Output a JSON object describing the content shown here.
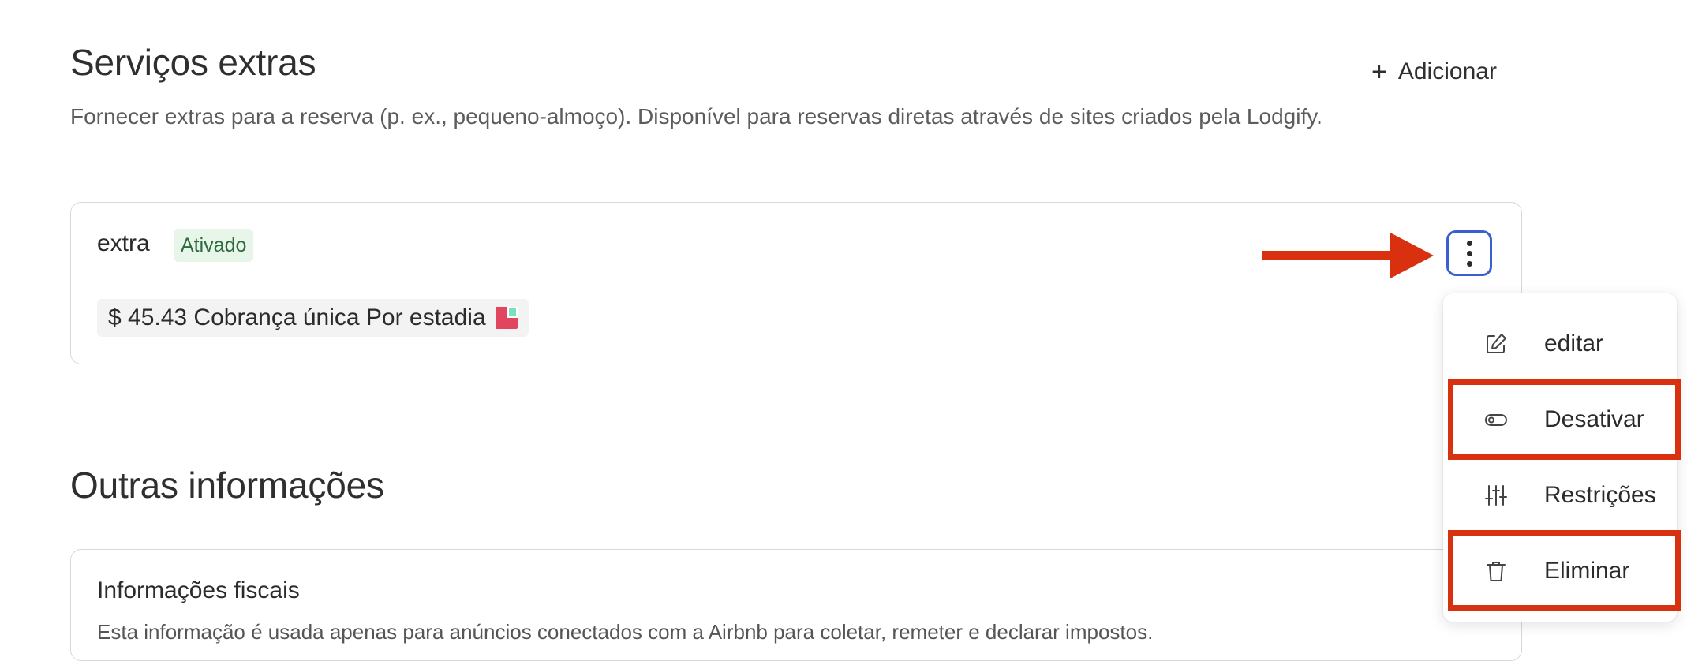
{
  "extras_section": {
    "title": "Serviços extras",
    "description": "Fornecer extras para a reserva (p. ex., pequeno-almoço). Disponível para reservas diretas através de sites criados pela Lodgify.",
    "add_button_label": "Adicionar",
    "add_button_icon": "plus-icon"
  },
  "extra_card": {
    "name": "extra",
    "status_badge": "Ativado",
    "price_text": "$ 45.43 Cobrança única Por estadia",
    "more_button_icon": "more-vertical-icon",
    "colors": {
      "badge_bg": "#e8f6ea",
      "badge_text": "#2f6b3f",
      "focus_ring": "#3b5fd0"
    }
  },
  "action_menu": {
    "items": [
      {
        "label": "editar",
        "icon": "edit-icon",
        "highlighted": false
      },
      {
        "label": "Desativar",
        "icon": "toggle-icon",
        "highlighted": true
      },
      {
        "label": "Restrições",
        "icon": "sliders-icon",
        "highlighted": false
      },
      {
        "label": "Eliminar",
        "icon": "trash-icon",
        "highlighted": true
      }
    ]
  },
  "annotations": {
    "arrow_color": "#d9300f",
    "highlight_color": "#d9300f"
  },
  "other_info_section": {
    "title": "Outras informações",
    "tax_card": {
      "title": "Informações fiscais",
      "description": "Esta informação é usada apenas para anúncios conectados com a Airbnb para coletar, remeter e declarar impostos."
    }
  }
}
